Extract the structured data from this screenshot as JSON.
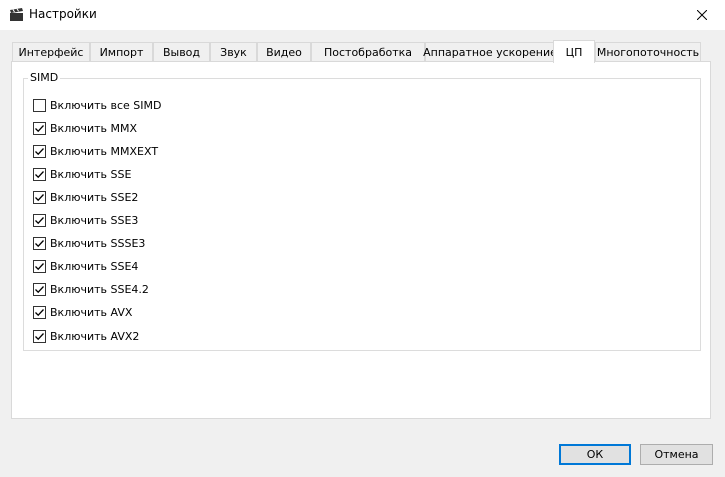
{
  "window": {
    "title": "Настройки"
  },
  "tabs": [
    {
      "label": "Интерфейс",
      "active": false
    },
    {
      "label": "Импорт",
      "active": false
    },
    {
      "label": "Вывод",
      "active": false
    },
    {
      "label": "Звук",
      "active": false
    },
    {
      "label": "Видео",
      "active": false
    },
    {
      "label": "Постобработка",
      "active": false
    },
    {
      "label": "Аппаратное ускорение",
      "active": false
    },
    {
      "label": "ЦП",
      "active": true
    },
    {
      "label": "Многопоточность",
      "active": false
    }
  ],
  "simd": {
    "title": "SIMD",
    "options": [
      {
        "label": "Включить все SIMD",
        "checked": false
      },
      {
        "label": "Включить MMX",
        "checked": true
      },
      {
        "label": "Включить MMXEXT",
        "checked": true
      },
      {
        "label": "Включить SSE",
        "checked": true
      },
      {
        "label": "Включить SSE2",
        "checked": true
      },
      {
        "label": "Включить SSE3",
        "checked": true
      },
      {
        "label": "Включить SSSE3",
        "checked": true
      },
      {
        "label": "Включить SSE4",
        "checked": true
      },
      {
        "label": "Включить SSE4.2",
        "checked": true
      },
      {
        "label": "Включить AVX",
        "checked": true
      },
      {
        "label": "Включить AVX2",
        "checked": true
      }
    ]
  },
  "buttons": {
    "ok": "ОК",
    "cancel": "Отмена"
  },
  "icons": {
    "app": "clapperboard-icon",
    "close": "close-icon",
    "check": "checkmark-icon"
  },
  "colors": {
    "accent": "#0078d7"
  }
}
